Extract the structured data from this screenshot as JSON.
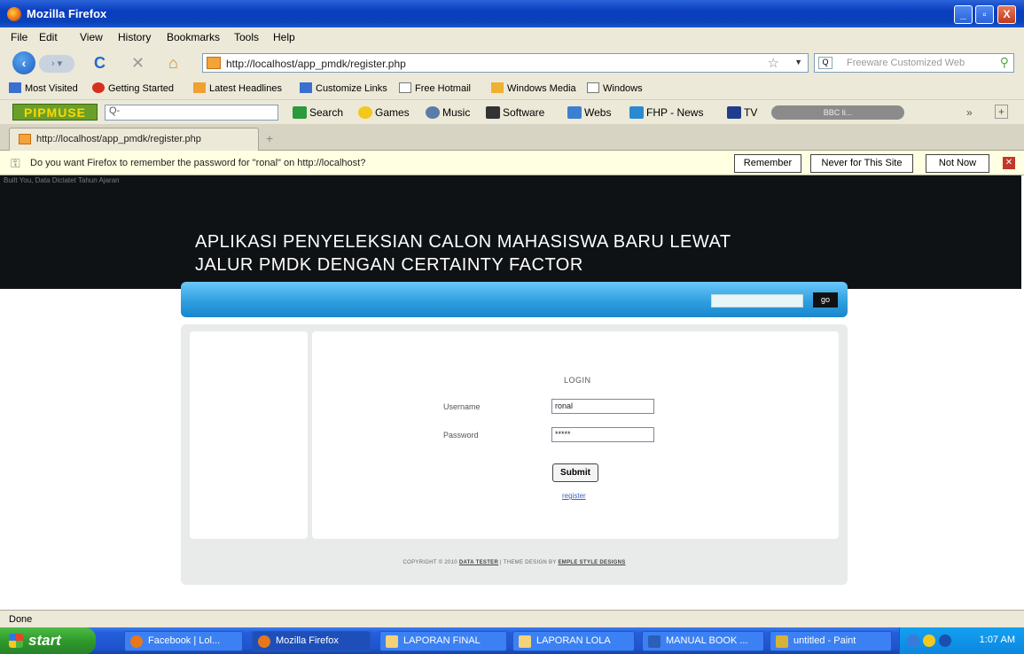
{
  "window": {
    "title": "Mozilla Firefox",
    "minimize": "_",
    "maximize": "▫",
    "close": "X"
  },
  "menu": [
    "File",
    "Edit",
    "View",
    "History",
    "Bookmarks",
    "Tools",
    "Help"
  ],
  "nav": {
    "url": "http://localhost/app_pmdk/register.php",
    "search_placeholder": "Freeware Customized Web"
  },
  "bookmarks": [
    "Most Visited",
    "Getting Started",
    "Latest Headlines",
    "Customize Links",
    "Free Hotmail",
    "Windows Media",
    "Windows"
  ],
  "toolbar2": {
    "brand": "PIPMUSE",
    "search_text": "Q-",
    "items": [
      "Search",
      "Games",
      "Music",
      "Software",
      "Webs",
      "FHP - News",
      "TV"
    ],
    "radio": "BBC li..."
  },
  "tab": {
    "label": "http://localhost/app_pmdk/register.php"
  },
  "notification": {
    "message": "Do you want Firefox to remember the password for \"ronal\" on http://localhost?",
    "remember": "Remember",
    "never": "Never for This Site",
    "not_now": "Not Now"
  },
  "page": {
    "tiny_text": "Built You, Data Dictatet Tahun Ajaran",
    "title_line1": "APLIKASI PENYELEKSIAN CALON MAHASISWA BARU LEWAT",
    "title_line2": "JALUR PMDK DENGAN CERTAINTY FACTOR",
    "search_button": "go",
    "login": {
      "title": "LOGIN",
      "username_label": "Username",
      "username_value": "ronal",
      "password_label": "Password",
      "password_value": "*****",
      "submit": "Submit",
      "register": "register"
    },
    "footer_prefix": "COPYRIGHT © 2010 ",
    "footer_link1": "DATA TESTER",
    "footer_mid": " | THEME DESIGN BY ",
    "footer_link2": "EMPLE STYLE DESIGNS"
  },
  "status": "Done",
  "taskbar": {
    "start": "start",
    "tasks": [
      "Facebook | Lol...",
      "Mozilla Firefox",
      "LAPORAN FINAL",
      "LAPORAN LOLA",
      "MANUAL BOOK ...",
      "untitled - Paint"
    ],
    "clock": "1:07 AM"
  }
}
